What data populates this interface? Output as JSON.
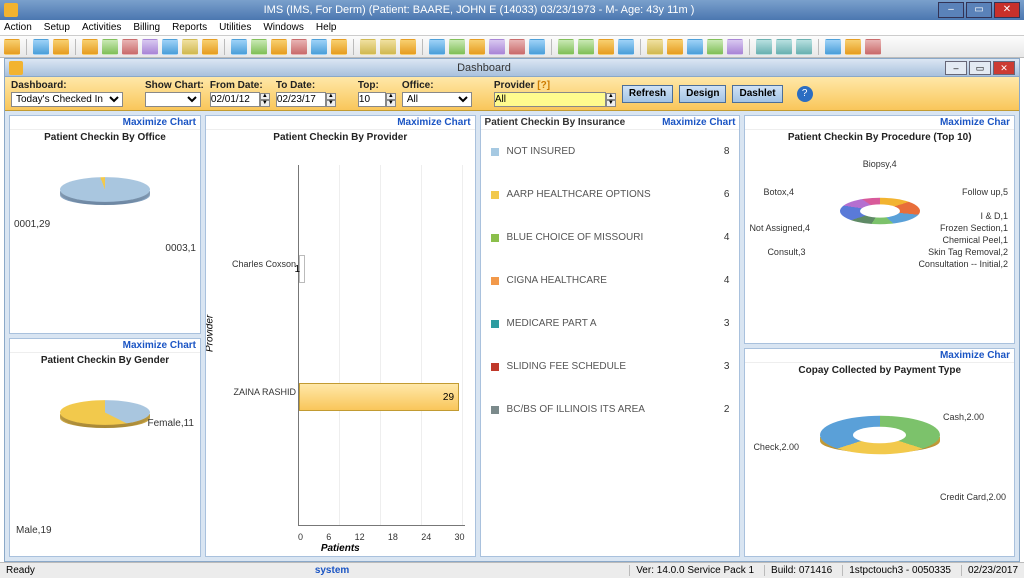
{
  "window": {
    "title": "IMS (IMS, For Derm)    (Patient: BAARE, JOHN E (14033) 03/23/1973 - M- Age: 43y 11m )"
  },
  "menu": [
    "Action",
    "Setup",
    "Activities",
    "Billing",
    "Reports",
    "Utilities",
    "Windows",
    "Help"
  ],
  "dashboard_window": {
    "title": "Dashboard"
  },
  "ribbon": {
    "dashboard_label": "Dashboard:",
    "dashboard_value": "Today's Checked In",
    "show_chart_label": "Show Chart:",
    "show_chart_value": "",
    "from_label": "From Date:",
    "from_value": "02/01/12",
    "to_label": "To Date:",
    "to_value": "02/23/17",
    "top_label": "Top:",
    "top_value": "10",
    "office_label": "Office:",
    "office_value": "All",
    "provider_label": "Provider",
    "provider_q": "[?]",
    "provider_value": "All",
    "buttons": {
      "refresh": "Refresh",
      "design": "Design",
      "dashlet": "Dashlet"
    }
  },
  "panels": {
    "office": {
      "title": "Patient Checkin By Office",
      "labels": {
        "a": "0001,29",
        "b": "0003,1"
      },
      "maximize": "Maximize  Chart"
    },
    "gender": {
      "title": "Patient Checkin By Gender",
      "labels": {
        "female": "Female,11",
        "male": "Male,19"
      },
      "maximize": "Maximize  Chart"
    },
    "provider": {
      "title": "Patient Checkin By Provider",
      "ylabel": "Provider",
      "xlabel": "Patients",
      "ticks": [
        "0",
        "6",
        "12",
        "18",
        "24",
        "30"
      ],
      "bars": [
        {
          "label": "Charles Coxson",
          "value": 1
        },
        {
          "label": "ZAINA RASHID",
          "value": 29
        }
      ],
      "maximize": "Maximize  Chart"
    },
    "insurance": {
      "head_left": "Patient Checkin By Insurance",
      "maximize": "Maximize  Chart",
      "rows": [
        {
          "color": "#a6c9e2",
          "name": "Not Insured",
          "value": 8
        },
        {
          "color": "#f2c94c",
          "name": "AARP HEALTHCARE OPTIONS",
          "value": 6
        },
        {
          "color": "#8bbf4b",
          "name": "BLUE CHOICE OF MISSOURI",
          "value": 4
        },
        {
          "color": "#f2994a",
          "name": "CIGNA HEALTHCARE",
          "value": 4
        },
        {
          "color": "#2d9ca0",
          "name": "Medicare part A",
          "value": 3
        },
        {
          "color": "#c0392b",
          "name": "Sliding Fee Schedule",
          "value": 3
        },
        {
          "color": "#7b8a8b",
          "name": "BC/BS OF ILLINOIS ITS AREA",
          "value": 2
        }
      ]
    },
    "procedure": {
      "title": "Patient Checkin By Procedure (Top 10)",
      "maximize": "Maximize  Char",
      "labels": {
        "biopsy": "Biopsy,4",
        "followup": "Follow up,5",
        "id": "I & D,1",
        "frozen": "Frozen Section,1",
        "chemical": "Chemical Peel,1",
        "skintag": "Skin Tag Removal,2",
        "consult_init": "Consultation -- Initial,2",
        "consult": "Consult,3",
        "notassigned": "Not Assigned,4",
        "botox": "Botox,4"
      }
    },
    "copay": {
      "title": "Copay Collected by Payment Type",
      "maximize": "Maximize  Char",
      "labels": {
        "cash": "Cash,2.00",
        "credit": "Credit Card,2.00",
        "check": "Check,2.00"
      }
    }
  },
  "status": {
    "ready": "Ready",
    "user": "system",
    "ver": "Ver: 14.0.0 Service Pack 1",
    "build": "Build: 071416",
    "station": "1stpctouch3 - 0050335",
    "date": "02/23/2017"
  },
  "chart_data": [
    {
      "type": "pie",
      "title": "Patient Checkin By Office",
      "categories": [
        "0001",
        "0003"
      ],
      "values": [
        29,
        1
      ]
    },
    {
      "type": "pie",
      "title": "Patient Checkin By Gender",
      "categories": [
        "Female",
        "Male"
      ],
      "values": [
        11,
        19
      ]
    },
    {
      "type": "bar",
      "title": "Patient Checkin By Provider",
      "orientation": "horizontal",
      "categories": [
        "Charles Coxson",
        "ZAINA RASHID"
      ],
      "values": [
        1,
        29
      ],
      "xlabel": "Patients",
      "ylabel": "Provider",
      "xlim": [
        0,
        30
      ]
    },
    {
      "type": "bar",
      "title": "Patient Checkin By Insurance",
      "categories": [
        "Not Insured",
        "AARP HEALTHCARE OPTIONS",
        "BLUE CHOICE OF MISSOURI",
        "CIGNA HEALTHCARE",
        "Medicare part A",
        "Sliding Fee Schedule",
        "BC/BS OF ILLINOIS ITS AREA"
      ],
      "values": [
        8,
        6,
        4,
        4,
        3,
        3,
        2
      ]
    },
    {
      "type": "pie",
      "title": "Patient Checkin By Procedure (Top 10)",
      "categories": [
        "Follow up",
        "Biopsy",
        "Botox",
        "Not Assigned",
        "Consult",
        "Consultation -- Initial",
        "Skin Tag Removal",
        "Chemical Peel",
        "Frozen Section",
        "I & D"
      ],
      "values": [
        5,
        4,
        4,
        4,
        3,
        2,
        2,
        1,
        1,
        1
      ]
    },
    {
      "type": "pie",
      "title": "Copay Collected by Payment Type",
      "categories": [
        "Cash",
        "Credit Card",
        "Check"
      ],
      "values": [
        2.0,
        2.0,
        2.0
      ]
    }
  ]
}
